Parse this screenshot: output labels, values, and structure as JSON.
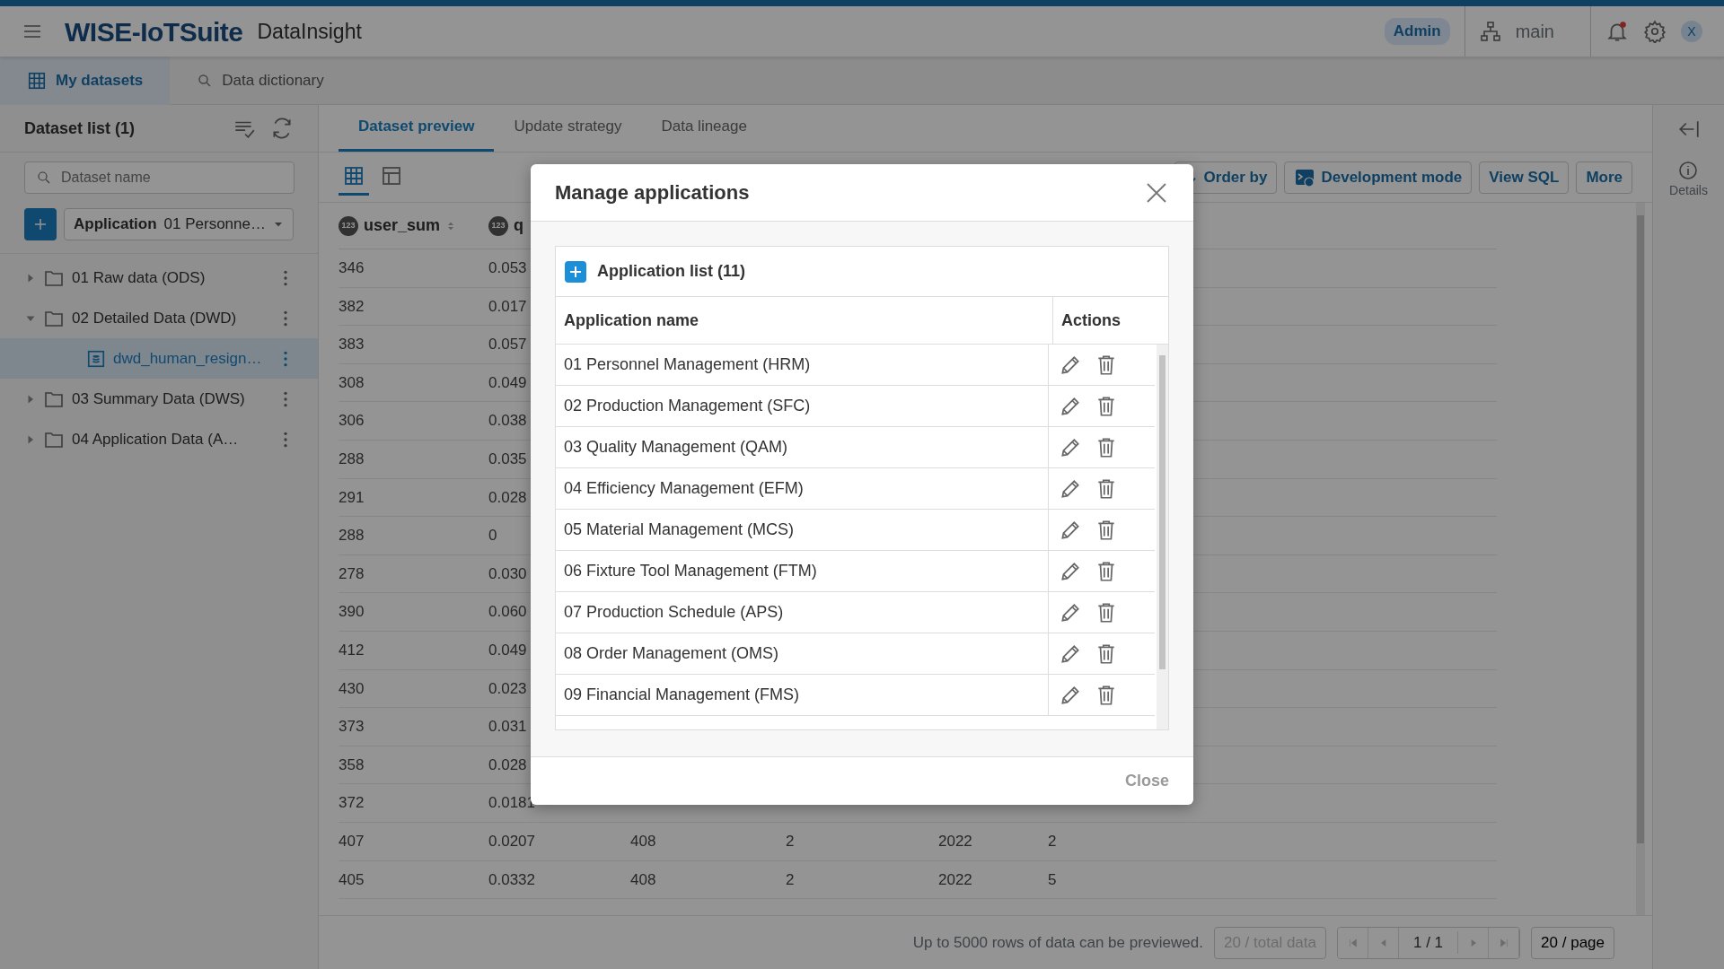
{
  "header": {
    "brand": "WISE-IoTSuite",
    "product": "DataInsight",
    "role": "Admin",
    "branch": "main",
    "avatar": "X",
    "notification": {
      "unread": true
    }
  },
  "nav_tabs": [
    {
      "label": "My datasets",
      "selected": true
    },
    {
      "label": "Data dictionary",
      "selected": false
    }
  ],
  "sidebar": {
    "title": "Dataset list (1)",
    "search": {
      "placeholder": "Dataset name"
    },
    "app_select": {
      "label": "Application",
      "value": "01 Personne…"
    },
    "tree": [
      {
        "label": "01 Raw data (ODS)",
        "kind": "folder",
        "expanded": false,
        "selected": false
      },
      {
        "label": "02 Detailed Data (DWD)",
        "kind": "folder",
        "expanded": true,
        "selected": false,
        "children": [
          {
            "label": "dwd_human_resign…",
            "kind": "dataset",
            "selected": true
          }
        ]
      },
      {
        "label": "03 Summary Data (DWS)",
        "kind": "folder",
        "expanded": false,
        "selected": false
      },
      {
        "label": "04 Application Data (A…",
        "kind": "folder",
        "expanded": false,
        "selected": false
      }
    ]
  },
  "content_tabs": [
    {
      "label": "Dataset preview",
      "selected": true
    },
    {
      "label": "Update strategy",
      "selected": false
    },
    {
      "label": "Data lineage",
      "selected": false
    }
  ],
  "view_modes": [
    {
      "kind": "grid",
      "selected": true
    },
    {
      "kind": "layout",
      "selected": false
    }
  ],
  "toolbar": [
    "Order by",
    "Development mode",
    "View SQL",
    "More"
  ],
  "details": "Details",
  "table": {
    "columns": [
      {
        "type_badge": "123",
        "label": "user_sum"
      },
      {
        "type_badge": "123",
        "label": "q"
      }
    ],
    "rows": [
      [
        "346",
        "0.053"
      ],
      [
        "382",
        "0.017"
      ],
      [
        "383",
        "0.057"
      ],
      [
        "308",
        "0.049"
      ],
      [
        "306",
        "0.038"
      ],
      [
        "288",
        "0.035"
      ],
      [
        "291",
        "0.028"
      ],
      [
        "288",
        "0"
      ],
      [
        "278",
        "0.030"
      ],
      [
        "390",
        "0.060"
      ],
      [
        "412",
        "0.049"
      ],
      [
        "430",
        "0.023"
      ],
      [
        "373",
        "0.031"
      ],
      [
        "358",
        "0.028"
      ],
      [
        "372",
        "0.0181"
      ],
      [
        "407",
        "0.0207",
        "408",
        "2",
        "2022",
        "2"
      ],
      [
        "405",
        "0.0332",
        "408",
        "2",
        "2022",
        "5"
      ]
    ]
  },
  "footer": {
    "note": "Up to 5000 rows of data can be previewed.",
    "total": "20 / total data",
    "page": "1 / 1",
    "page_size": "20 / page"
  },
  "modal": {
    "title": "Manage applications",
    "list_title": "Application list (11)",
    "columns": [
      "Application name",
      "Actions"
    ],
    "rows": [
      "01 Personnel Management (HRM)",
      "02 Production Management (SFC)",
      "03 Quality Management (QAM)",
      "04 Efficiency Management (EFM)",
      "05 Material Management (MCS)",
      "06 Fixture Tool Management (FTM)",
      "07 Production Schedule (APS)",
      "08 Order Management (OMS)",
      "09 Financial Management (FMS)"
    ],
    "close": "Close"
  }
}
